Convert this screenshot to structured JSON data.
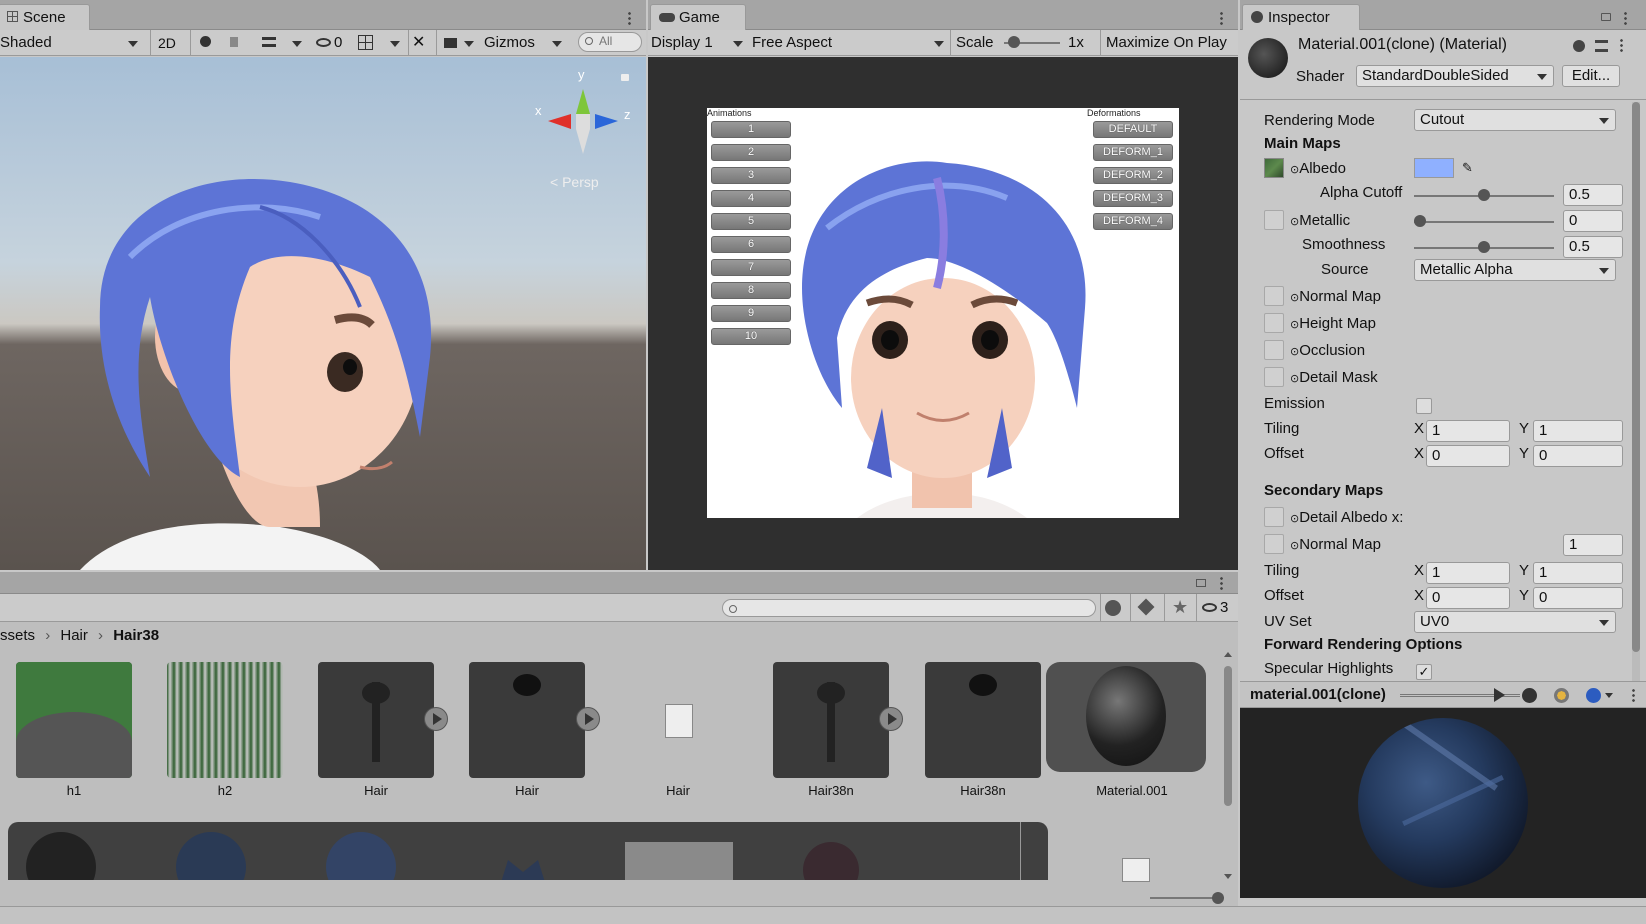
{
  "scene": {
    "tab": "Scene",
    "shading": "Shaded",
    "mode_2d": "2D",
    "hidden_count": "0",
    "gizmos": "Gizmos",
    "search_placeholder": "All",
    "axis_x": "x",
    "axis_y": "y",
    "axis_z": "z",
    "persp": "Persp"
  },
  "game": {
    "tab": "Game",
    "display": "Display 1",
    "aspect": "Free Aspect",
    "scale_label": "Scale",
    "scale_value": "1x",
    "maximize": "Maximize On Play",
    "animations_header": "Animations",
    "deformations_header": "Deformations",
    "animation_buttons": [
      "1",
      "2",
      "3",
      "4",
      "5",
      "6",
      "7",
      "8",
      "9",
      "10"
    ],
    "deform_buttons": [
      "DEFAULT",
      "DEFORM_1",
      "DEFORM_2",
      "DEFORM_3",
      "DEFORM_4"
    ]
  },
  "inspector": {
    "tab": "Inspector",
    "title": "Material.001(clone) (Material)",
    "shader_label": "Shader",
    "shader_value": "StandardDoubleSided",
    "edit_button": "Edit...",
    "rendering_mode_label": "Rendering Mode",
    "rendering_mode_value": "Cutout",
    "main_maps": "Main Maps",
    "albedo": "Albedo",
    "albedo_color": "#8fb0ff",
    "alpha_cutoff_label": "Alpha Cutoff",
    "alpha_cutoff_value": "0.5",
    "alpha_cutoff_level": 0.5,
    "metallic_label": "Metallic",
    "metallic_value": "0",
    "metallic_level": 0,
    "smoothness_label": "Smoothness",
    "smoothness_value": "0.5",
    "smoothness_level": 0.5,
    "source_label": "Source",
    "source_value": "Metallic Alpha",
    "normal_map": "Normal Map",
    "height_map": "Height Map",
    "occlusion": "Occlusion",
    "detail_mask": "Detail Mask",
    "emission": "Emission",
    "tiling": "Tiling",
    "offset": "Offset",
    "x": "X",
    "y": "Y",
    "tiling_x": "1",
    "tiling_y": "1",
    "offset_x": "0",
    "offset_y": "0",
    "secondary_maps": "Secondary Maps",
    "detail_albedo": "Detail Albedo x:",
    "secondary_normal_map": "Normal Map",
    "secondary_normal_value": "1",
    "sec_tiling_x": "1",
    "sec_tiling_y": "1",
    "sec_offset_x": "0",
    "sec_offset_y": "0",
    "uv_set_label": "UV Set",
    "uv_set_value": "UV0",
    "forward_rendering": "Forward Rendering Options",
    "specular_highlights": "Specular Highlights",
    "preview_name": "material.001(clone)"
  },
  "project": {
    "hidden_count": "3",
    "breadcrumb": [
      "ssets",
      "Hair",
      "Hair38"
    ],
    "assets": [
      {
        "label": "h1"
      },
      {
        "label": "h2"
      },
      {
        "label": "Hair"
      },
      {
        "label": "Hair"
      },
      {
        "label": "Hair"
      },
      {
        "label": "Hair38n"
      },
      {
        "label": "Hair38n"
      },
      {
        "label": "Material.001"
      }
    ]
  }
}
